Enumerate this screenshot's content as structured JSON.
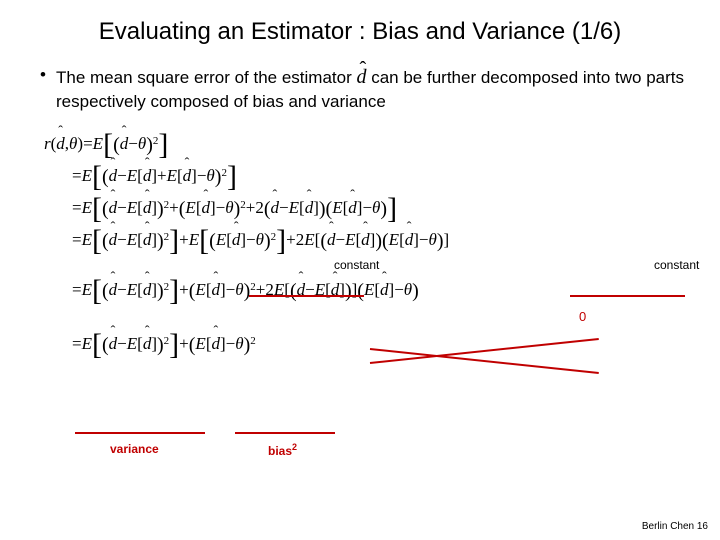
{
  "title": "Evaluating an Estimator : Bias and Variance (1/6)",
  "bullet_pre": "The mean square error of the estimator ",
  "bullet_dhat": "d",
  "bullet_post": " can be further decomposed into two parts respectively composed of bias and variance",
  "eq": {
    "line1_lhs_r": "r",
    "line1_lhs_open": "(",
    "line1_lhs_d": "d",
    "line1_lhs_comma": " , ",
    "line1_lhs_theta": "θ",
    "line1_lhs_close": ")",
    "eq_sym": " = ",
    "E": "E",
    "open_big_l": "[",
    "close_big_r": "]",
    "open_par": "(",
    "close_par": ")",
    "d": "d",
    "minus": " − ",
    "plus": " + ",
    "theta": "θ",
    "two": "2",
    "times2": "2",
    "zero": "0"
  },
  "annot": {
    "constant1": "constant",
    "constant2": "constant",
    "zero": "0",
    "variance": "variance",
    "bias": "bias",
    "bias_sup": "2"
  },
  "footer": "Berlin Chen 16",
  "chart_data": {
    "type": "table",
    "description": "Mathematical derivation decomposing MSE of estimator d-hat into variance + bias^2",
    "steps": [
      "r(d,θ) = E[(d−θ)^2]",
      "= E[(d − E[d] + E[d] − θ)^2]",
      "= E[(d − E[d])^2 + (E[d] − θ)^2 + 2(d − E[d])(E[d] − θ)]",
      "= E[(d − E[d])^2] + E[(E[d] − θ)^2] + 2E[(d − E[d])(E[d] − θ)]",
      "(middle and last terms involve constants; cross term = 0)",
      "= E[(d − E[d])^2] + (E[d] − θ)^2 + 2E[(d − E[d])](E[d] − θ)",
      "= E[(d − E[d])^2] + (E[d] − θ)^2",
      "variance + bias^2"
    ]
  }
}
